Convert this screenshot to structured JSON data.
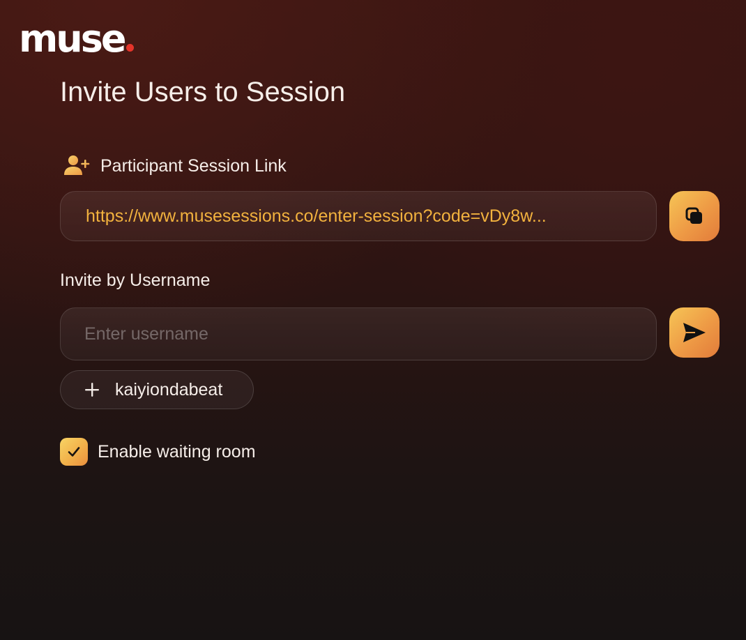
{
  "app": {
    "logo_text": "muse",
    "logo_dot_color": "#e5342a"
  },
  "page": {
    "title": "Invite Users to Session"
  },
  "participant_link": {
    "label": "Participant Session Link",
    "label_icon": "user-plus-icon",
    "url": "https://www.musesessions.co/enter-session?code=vDy8w...",
    "url_color": "#f2b23e",
    "copy_icon": "copy-icon"
  },
  "invite": {
    "label": "Invite by Username",
    "placeholder": "Enter username",
    "value": "",
    "send_icon": "send-icon",
    "suggestions": [
      {
        "icon": "plus-icon",
        "username": "kaiyiondabeat"
      }
    ]
  },
  "waiting_room": {
    "label": "Enable waiting room",
    "checked": true
  },
  "colors": {
    "accent_start": "#f6c556",
    "accent_end": "#e27b3a"
  }
}
